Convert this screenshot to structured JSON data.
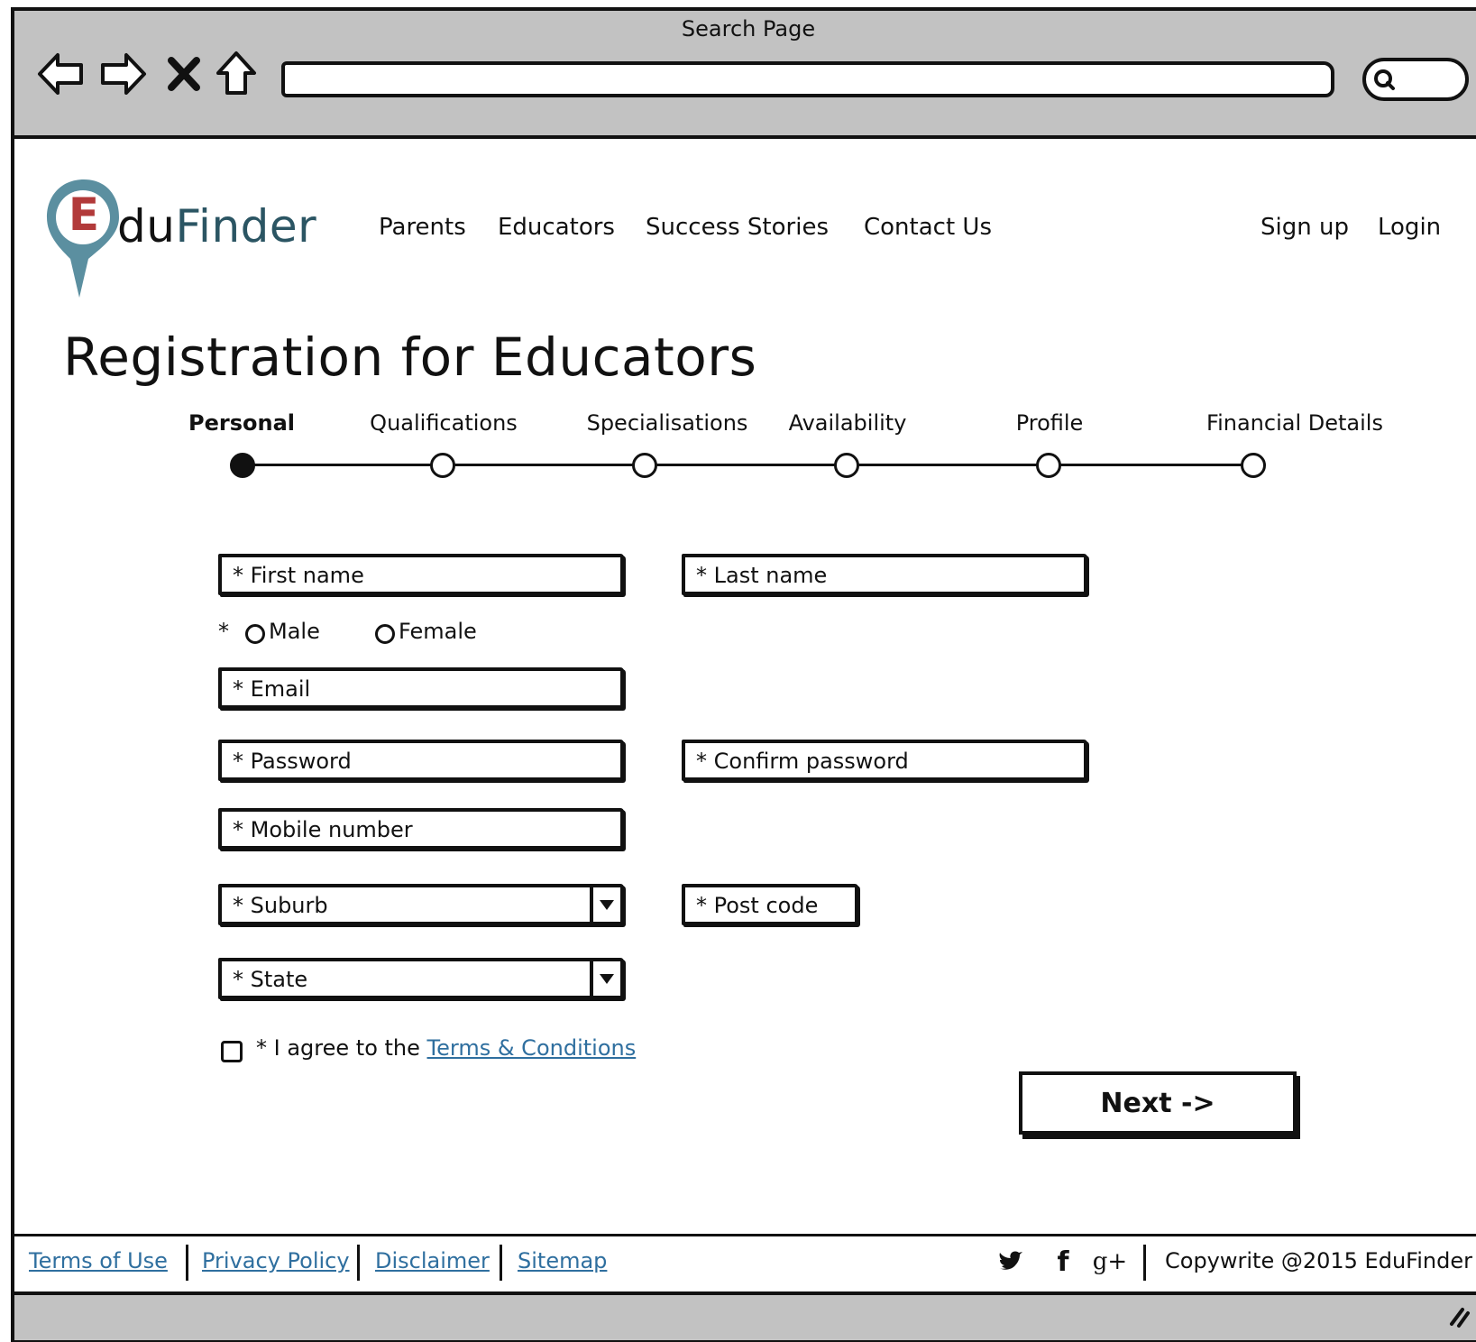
{
  "browser": {
    "title": "Search Page",
    "address": ""
  },
  "brand": {
    "logo_letter": "E",
    "logo_text_a": "du",
    "logo_text_b": "Finder",
    "colors": {
      "pin": "#5b8fa0",
      "letter": "#b23a3a",
      "link": "#2f6f9f"
    }
  },
  "nav": {
    "items": [
      "Parents",
      "Educators",
      "Success Stories",
      "Contact Us"
    ],
    "signup": "Sign up",
    "login": "Login"
  },
  "page": {
    "title": "Registration for Educators"
  },
  "stepper": {
    "steps": [
      "Personal",
      "Qualifications",
      "Specialisations",
      "Availability",
      "Profile",
      "Financial Details"
    ],
    "active_index": 0
  },
  "form": {
    "first_name": "* First name",
    "last_name": "* Last name",
    "gender_required": "*",
    "gender_options": [
      "Male",
      "Female"
    ],
    "email": "* Email",
    "password": "* Password",
    "confirm_password": "* Confirm password",
    "mobile": "* Mobile number",
    "suburb": "* Suburb",
    "post_code": "* Post code",
    "state": "* State",
    "agree_text": "* I agree to the",
    "terms_link": "Terms & Conditions",
    "next_label": "Next ->"
  },
  "footer": {
    "links": [
      "Terms of Use",
      "Privacy Policy",
      "Disclaimer",
      "Sitemap"
    ],
    "social_icons": [
      "twitter-icon",
      "facebook-icon",
      "google-plus-icon"
    ],
    "google_plus_glyph": "g+",
    "facebook_glyph": "f",
    "copyright": "Copywrite @2015 EduFinder"
  }
}
